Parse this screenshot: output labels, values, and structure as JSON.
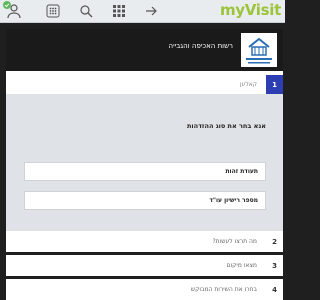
{
  "topbar": {
    "icons": [
      "user-icon",
      "grid-icon",
      "search-icon",
      "apps-icon",
      "forward-icon"
    ],
    "logo_text": "myVisit"
  },
  "header": {
    "title": "רשות האכיפה והגבייה"
  },
  "steps": [
    {
      "num": "1",
      "label": "קאלען",
      "active": true
    },
    {
      "num": "2",
      "label": "מה תרצו לעשות?"
    },
    {
      "num": "3",
      "label": "מצאו מיקום"
    },
    {
      "num": "4",
      "label": "בחרו את השירות המבוקש"
    }
  ],
  "content": {
    "question": "אנא בחר את סוג ההזדהות",
    "options": [
      "תעודת זהות",
      "מספר רישיון עו\"ד"
    ]
  },
  "colors": {
    "accent": "#2d3eb3",
    "logo": "#9cc43a",
    "header_bg": "#1a1a1a",
    "content_bg": "#dfe2e6"
  }
}
